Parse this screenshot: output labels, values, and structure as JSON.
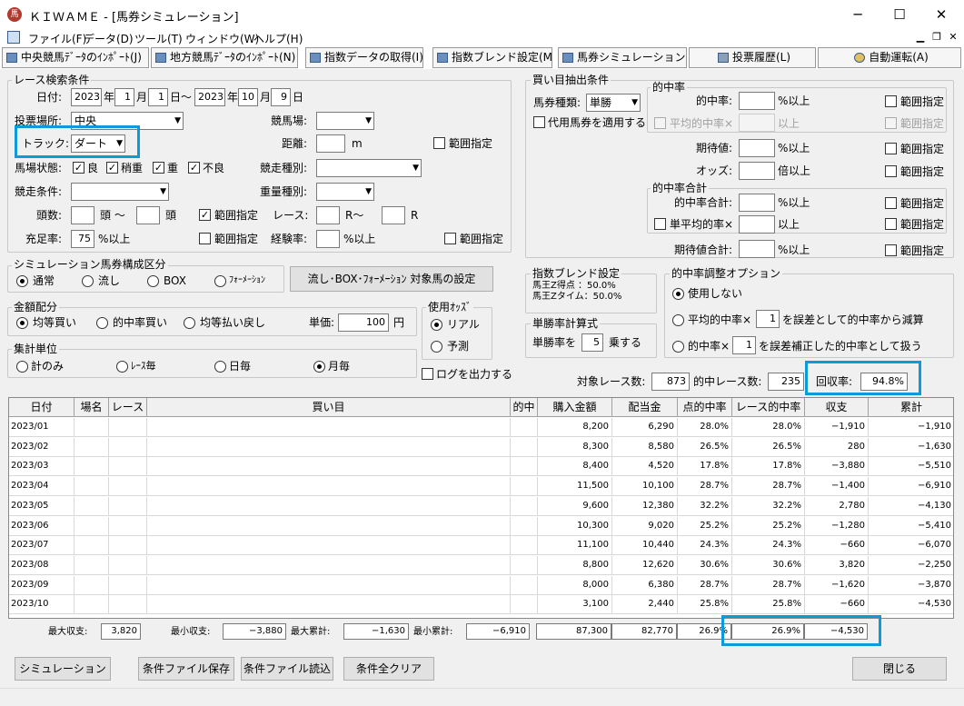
{
  "window": {
    "title": "ＫＩＷＡＭＥ - [馬券シミュレーション]",
    "icon": "app-logo-icon"
  },
  "menu": [
    "ファイル(F)",
    "データ(D)",
    "ツール(T)",
    "ウィンドウ(W)",
    "ヘルプ(H)"
  ],
  "toolbar": [
    "中央競馬ﾃﾞｰﾀのｲﾝﾎﾟｰﾄ(J)",
    "地方競馬ﾃﾞｰﾀのｲﾝﾎﾟｰﾄ(N)",
    "指数データの取得(I)",
    "指数ブレンド設定(M)",
    "馬券シミュレーション(B)",
    "投票履歴(L)",
    "自動運転(A)"
  ],
  "search": {
    "title": "レース検索条件",
    "date_label": "日付:",
    "y1": "2023",
    "m1": "1",
    "d1": "1",
    "y2": "2023",
    "m2": "10",
    "d2": "9",
    "u_year": "年",
    "u_month": "月",
    "u_day": "日",
    "u_day_range": "日～",
    "venue_label": "投票場所:",
    "venue": "中央",
    "track_label": "トラック:",
    "track": "ダート",
    "course_label": "競馬場:",
    "course": "",
    "distance_label": "距離:",
    "distance": "",
    "unit_m": "m",
    "range": "範囲指定",
    "baba_label": "馬場状態:",
    "baba": [
      {
        "label": "良",
        "checked": true
      },
      {
        "label": "稍重",
        "checked": true
      },
      {
        "label": "重",
        "checked": true
      },
      {
        "label": "不良",
        "checked": true
      }
    ],
    "race_type_label": "競走種別:",
    "cond_label": "競走条件:",
    "weight_label": "重量種別:",
    "heads_label": "頭数:",
    "heads_unit": "頭 ～",
    "heads_unit2": "頭",
    "race_label": "レース:",
    "r_unit": "R～",
    "r_unit2": "R",
    "fill_label": "充足率:",
    "fill_value": "75",
    "fill_unit": "%以上",
    "exp_label": "経験率:",
    "exp_unit": "%以上"
  },
  "composition": {
    "title": "シミュレーション馬券構成区分",
    "options": [
      "通常",
      "流し",
      "BOX",
      "ﾌｫｰﾒｰｼｮﾝ"
    ],
    "selected": 0,
    "button": "流し･BOX･ﾌｫｰﾒｰｼｮﾝ 対象馬の設定"
  },
  "amount": {
    "title": "金額配分",
    "options": [
      "均等買い",
      "的中率買い",
      "均等払い戻し"
    ],
    "selected": 0,
    "unit_price_label": "単価:",
    "unit_price": "100",
    "yen": "円"
  },
  "odds": {
    "title": "使用ｵｯｽﾞ",
    "options": [
      "リアル",
      "予測"
    ],
    "selected": 0
  },
  "aggregation": {
    "title": "集計単位",
    "options": [
      "計のみ",
      "ﾚｰｽ毎",
      "日毎",
      "月毎"
    ],
    "selected": 3
  },
  "log_label": "ログを出力する",
  "buy": {
    "title": "買い目抽出条件",
    "kind_label": "馬券種類:",
    "kind": "単勝",
    "substitute": "代用馬券を適用する",
    "hit_title": "的中率",
    "hit_label": "的中率:",
    "avg_hit_label": "平均的中率×",
    "pct_over": "%以上",
    "over": "以上",
    "times_over": "倍以上",
    "exp_label": "期待値:",
    "odds_label": "オッズ:",
    "sum_title": "的中率合計",
    "hit_sum_label": "的中率合計:",
    "single_avg_label": "単平均的率×",
    "exp_sum_label": "期待値合計:"
  },
  "blend": {
    "title": "指数ブレンド設定",
    "line1": "馬王Z得点 ：50.0%",
    "line2": "馬王Zタイム：50.0%"
  },
  "winrate": {
    "title": "単勝率計算式",
    "label": "単勝率を",
    "value": "5",
    "unit": "乗する"
  },
  "adjust": {
    "title": "的中率調整オプション",
    "opt1": "使用しない",
    "opt2a": "平均的中率×",
    "opt2v": "1",
    "opt2b": "を誤差として的中率から減算",
    "opt3a": "的中率×",
    "opt3v": "1",
    "opt3b": "を誤差補正した的中率として扱う"
  },
  "stats": {
    "target_label": "対象レース数:",
    "target": "873",
    "hit_label": "的中レース数:",
    "hit": "235",
    "recovery_label": "回収率:",
    "recovery": "94.8%"
  },
  "table": {
    "columns": [
      "日付",
      "場名",
      "レース",
      "買い目",
      "的中",
      "購入金額",
      "配当金",
      "点的中率",
      "レース的中率",
      "収支",
      "累計"
    ],
    "rows": [
      [
        "2023/01",
        "",
        "",
        "",
        "",
        "8,200",
        "6,290",
        "28.0%",
        "28.0%",
        "−1,910",
        "−1,910"
      ],
      [
        "2023/02",
        "",
        "",
        "",
        "",
        "8,300",
        "8,580",
        "26.5%",
        "26.5%",
        "280",
        "−1,630"
      ],
      [
        "2023/03",
        "",
        "",
        "",
        "",
        "8,400",
        "4,520",
        "17.8%",
        "17.8%",
        "−3,880",
        "−5,510"
      ],
      [
        "2023/04",
        "",
        "",
        "",
        "",
        "11,500",
        "10,100",
        "28.7%",
        "28.7%",
        "−1,400",
        "−6,910"
      ],
      [
        "2023/05",
        "",
        "",
        "",
        "",
        "9,600",
        "12,380",
        "32.2%",
        "32.2%",
        "2,780",
        "−4,130"
      ],
      [
        "2023/06",
        "",
        "",
        "",
        "",
        "10,300",
        "9,020",
        "25.2%",
        "25.2%",
        "−1,280",
        "−5,410"
      ],
      [
        "2023/07",
        "",
        "",
        "",
        "",
        "11,100",
        "10,440",
        "24.3%",
        "24.3%",
        "−660",
        "−6,070"
      ],
      [
        "2023/08",
        "",
        "",
        "",
        "",
        "8,800",
        "12,620",
        "30.6%",
        "30.6%",
        "3,820",
        "−2,250"
      ],
      [
        "2023/09",
        "",
        "",
        "",
        "",
        "8,000",
        "6,380",
        "28.7%",
        "28.7%",
        "−1,620",
        "−3,870"
      ],
      [
        "2023/10",
        "",
        "",
        "",
        "",
        "3,100",
        "2,440",
        "25.8%",
        "25.8%",
        "−660",
        "−4,530"
      ]
    ]
  },
  "summary": {
    "max_profit_label": "最大収支:",
    "max_profit": "3,820",
    "min_profit_label": "最小収支:",
    "min_profit": "−3,880",
    "max_cum_label": "最大累計:",
    "max_cum": "−1,630",
    "min_cum_label": "最小累計:",
    "min_cum": "−6,910",
    "total_buy": "87,300",
    "total_pay": "82,770",
    "point_hit": "26.9%",
    "race_hit": "26.9%",
    "balance": "−4,530"
  },
  "buttons": {
    "simulate": "シミュレーション",
    "save": "条件ファイル保存",
    "load": "条件ファイル読込",
    "clear": "条件全クリア",
    "close": "閉じる"
  }
}
